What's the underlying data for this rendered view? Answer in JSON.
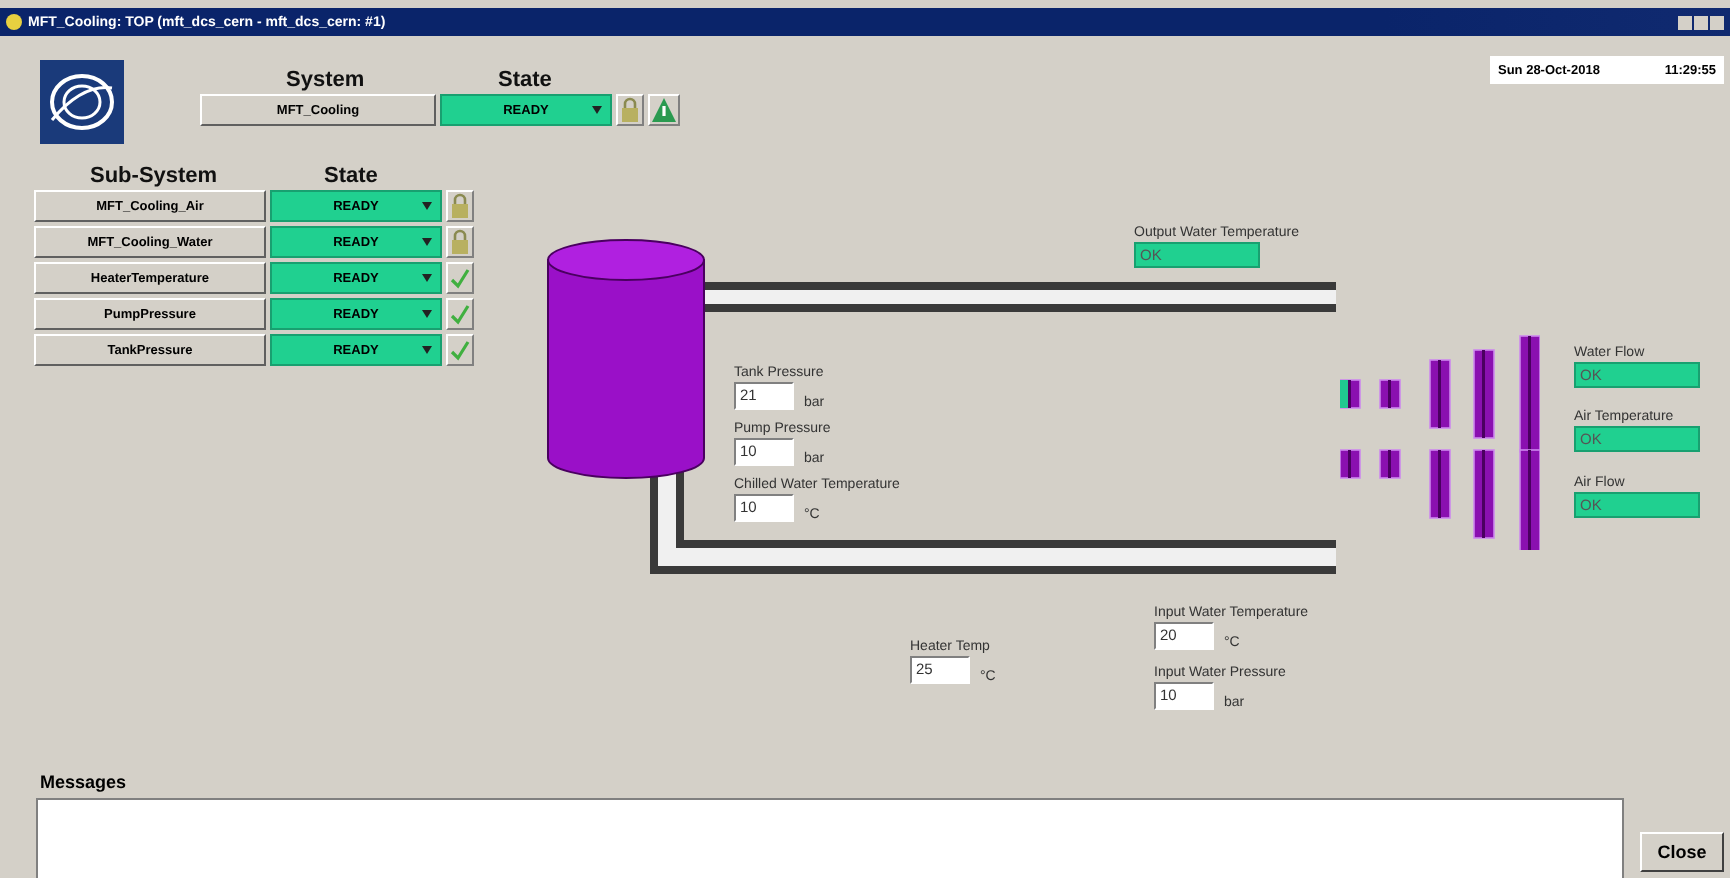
{
  "window": {
    "title": "MFT_Cooling: TOP (mft_dcs_cern - mft_dcs_cern: #1)"
  },
  "clock": {
    "date": "Sun 28-Oct-2018",
    "time": "11:29:55"
  },
  "system": {
    "header_name": "System",
    "header_state": "State",
    "name": "MFT_Cooling",
    "state": "READY"
  },
  "subsystems": {
    "header_name": "Sub-System",
    "header_state": "State",
    "rows": [
      {
        "name": "MFT_Cooling_Air",
        "state": "READY",
        "kind": "lock"
      },
      {
        "name": "MFT_Cooling_Water",
        "state": "READY",
        "kind": "lock"
      },
      {
        "name": "HeaterTemperature",
        "state": "READY",
        "kind": "check"
      },
      {
        "name": "PumpPressure",
        "state": "READY",
        "kind": "check"
      },
      {
        "name": "TankPressure",
        "state": "READY",
        "kind": "check"
      }
    ]
  },
  "fields": [
    {
      "label": "Tank Pressure",
      "value": "21",
      "unit": "bar"
    },
    {
      "label": "Pump Pressure",
      "value": "10",
      "unit": "bar"
    },
    {
      "label": "Chilled Water Temperature",
      "value": "10",
      "unit": "°C"
    },
    {
      "label": "Heater Temp",
      "value": "25",
      "unit": "°C"
    },
    {
      "label": "Input Water Temperature",
      "value": "20",
      "unit": "°C"
    },
    {
      "label": "Input Water Pressure",
      "value": "10",
      "unit": "bar"
    }
  ],
  "indicators": [
    {
      "label": "Output Water Temperature",
      "status": "OK"
    },
    {
      "label": "Water Flow",
      "status": "OK"
    },
    {
      "label": "Air Temperature",
      "status": "OK"
    },
    {
      "label": "Air Flow",
      "status": "OK"
    }
  ],
  "messages": {
    "label": "Messages"
  },
  "close_button": "Close"
}
